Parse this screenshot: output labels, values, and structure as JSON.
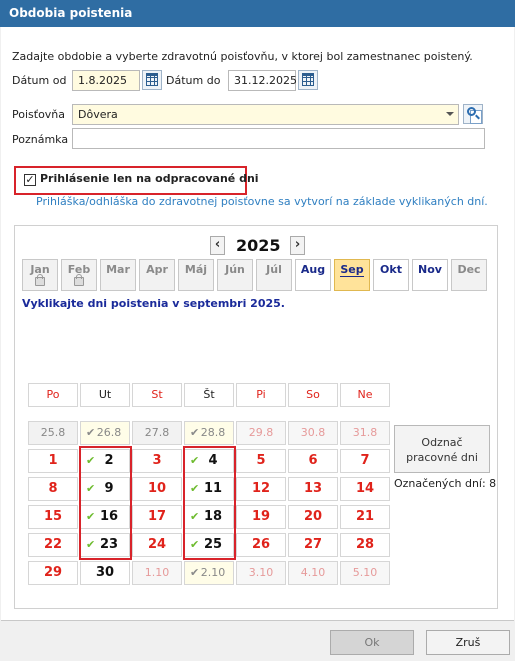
{
  "window": {
    "title": "Obdobia poistenia"
  },
  "intro": "Zadajte obdobie a vyberte zdravotnú poisťovňu, v ktorej bol zamestnanec poistený.",
  "form": {
    "date_from_label": "Dátum od",
    "date_from_value": "1.8.2025",
    "date_to_label": "Dátum do",
    "date_to_value": "31.12.2025",
    "insurer_label": "Poisťovňa",
    "insurer_value": "Dôvera",
    "note_label": "Poznámka",
    "note_value": ""
  },
  "registration": {
    "checkbox_label": "Prihlásenie len na odpracované dni",
    "checked": true,
    "info": "Prihláška/odhláška do zdravotnej poisťovne sa vytvorí na základe vyklikaných dní."
  },
  "calendar": {
    "year": "2025",
    "months": [
      {
        "label": "Jan",
        "state": "past",
        "locked": true
      },
      {
        "label": "Feb",
        "state": "past",
        "locked": true
      },
      {
        "label": "Mar",
        "state": "past",
        "locked": false
      },
      {
        "label": "Apr",
        "state": "past",
        "locked": false
      },
      {
        "label": "Máj",
        "state": "past",
        "locked": false
      },
      {
        "label": "Jún",
        "state": "past",
        "locked": false
      },
      {
        "label": "Júl",
        "state": "past",
        "locked": false
      },
      {
        "label": "Aug",
        "state": "future",
        "locked": false
      },
      {
        "label": "Sep",
        "state": "selected",
        "locked": false
      },
      {
        "label": "Okt",
        "state": "future",
        "locked": false
      },
      {
        "label": "Nov",
        "state": "future",
        "locked": false
      },
      {
        "label": "Dec",
        "state": "past",
        "locked": false
      }
    ],
    "instruction": "Vyklikajte dni poistenia v septembri 2025.",
    "weekdays": [
      "Po",
      "Ut",
      "St",
      "Št",
      "Pi",
      "So",
      "Ne"
    ],
    "weekday_colors": [
      "#e0231b",
      "#222222",
      "#e0231b",
      "#222222",
      "#e0231b",
      "#e0231b",
      "#e0231b"
    ],
    "weeks": [
      [
        {
          "t": "25.8",
          "k": "other"
        },
        {
          "t": "26.8",
          "k": "other",
          "c": true
        },
        {
          "t": "27.8",
          "k": "other"
        },
        {
          "t": "28.8",
          "k": "other",
          "c": true
        },
        {
          "t": "29.8",
          "k": "otherwe"
        },
        {
          "t": "30.8",
          "k": "otherwe"
        },
        {
          "t": "31.8",
          "k": "otherwe"
        }
      ],
      [
        {
          "t": "1",
          "k": "cur"
        },
        {
          "t": "2",
          "k": "work",
          "c": true
        },
        {
          "t": "3",
          "k": "cur"
        },
        {
          "t": "4",
          "k": "work",
          "c": true
        },
        {
          "t": "5",
          "k": "cur"
        },
        {
          "t": "6",
          "k": "cur"
        },
        {
          "t": "7",
          "k": "cur"
        }
      ],
      [
        {
          "t": "8",
          "k": "cur"
        },
        {
          "t": "9",
          "k": "work",
          "c": true
        },
        {
          "t": "10",
          "k": "cur"
        },
        {
          "t": "11",
          "k": "work",
          "c": true
        },
        {
          "t": "12",
          "k": "cur"
        },
        {
          "t": "13",
          "k": "cur"
        },
        {
          "t": "14",
          "k": "cur"
        }
      ],
      [
        {
          "t": "15",
          "k": "cur"
        },
        {
          "t": "16",
          "k": "work",
          "c": true
        },
        {
          "t": "17",
          "k": "cur"
        },
        {
          "t": "18",
          "k": "work",
          "c": true
        },
        {
          "t": "19",
          "k": "cur"
        },
        {
          "t": "20",
          "k": "cur"
        },
        {
          "t": "21",
          "k": "cur"
        }
      ],
      [
        {
          "t": "22",
          "k": "cur"
        },
        {
          "t": "23",
          "k": "work",
          "c": true
        },
        {
          "t": "24",
          "k": "cur"
        },
        {
          "t": "25",
          "k": "work",
          "c": true
        },
        {
          "t": "26",
          "k": "cur"
        },
        {
          "t": "27",
          "k": "cur"
        },
        {
          "t": "28",
          "k": "cur"
        }
      ],
      [
        {
          "t": "29",
          "k": "cur"
        },
        {
          "t": "30",
          "k": "work"
        },
        {
          "t": "1.10",
          "k": "otherwe"
        },
        {
          "t": "2.10",
          "k": "other",
          "c": true
        },
        {
          "t": "3.10",
          "k": "otherwe"
        },
        {
          "t": "4.10",
          "k": "otherwe"
        },
        {
          "t": "5.10",
          "k": "otherwe"
        }
      ]
    ],
    "mark_workdays_label": "Odznač pracovné dni",
    "marked_count_label": "Označených dní: 8"
  },
  "footer": {
    "ok_label": "Ok",
    "cancel_label": "Zruš"
  },
  "colors": {
    "title_bar": "#2f6da3",
    "highlight_frame": "#d8232a",
    "info_text": "#2f7fc1",
    "selected_month": "#ffe39a"
  }
}
